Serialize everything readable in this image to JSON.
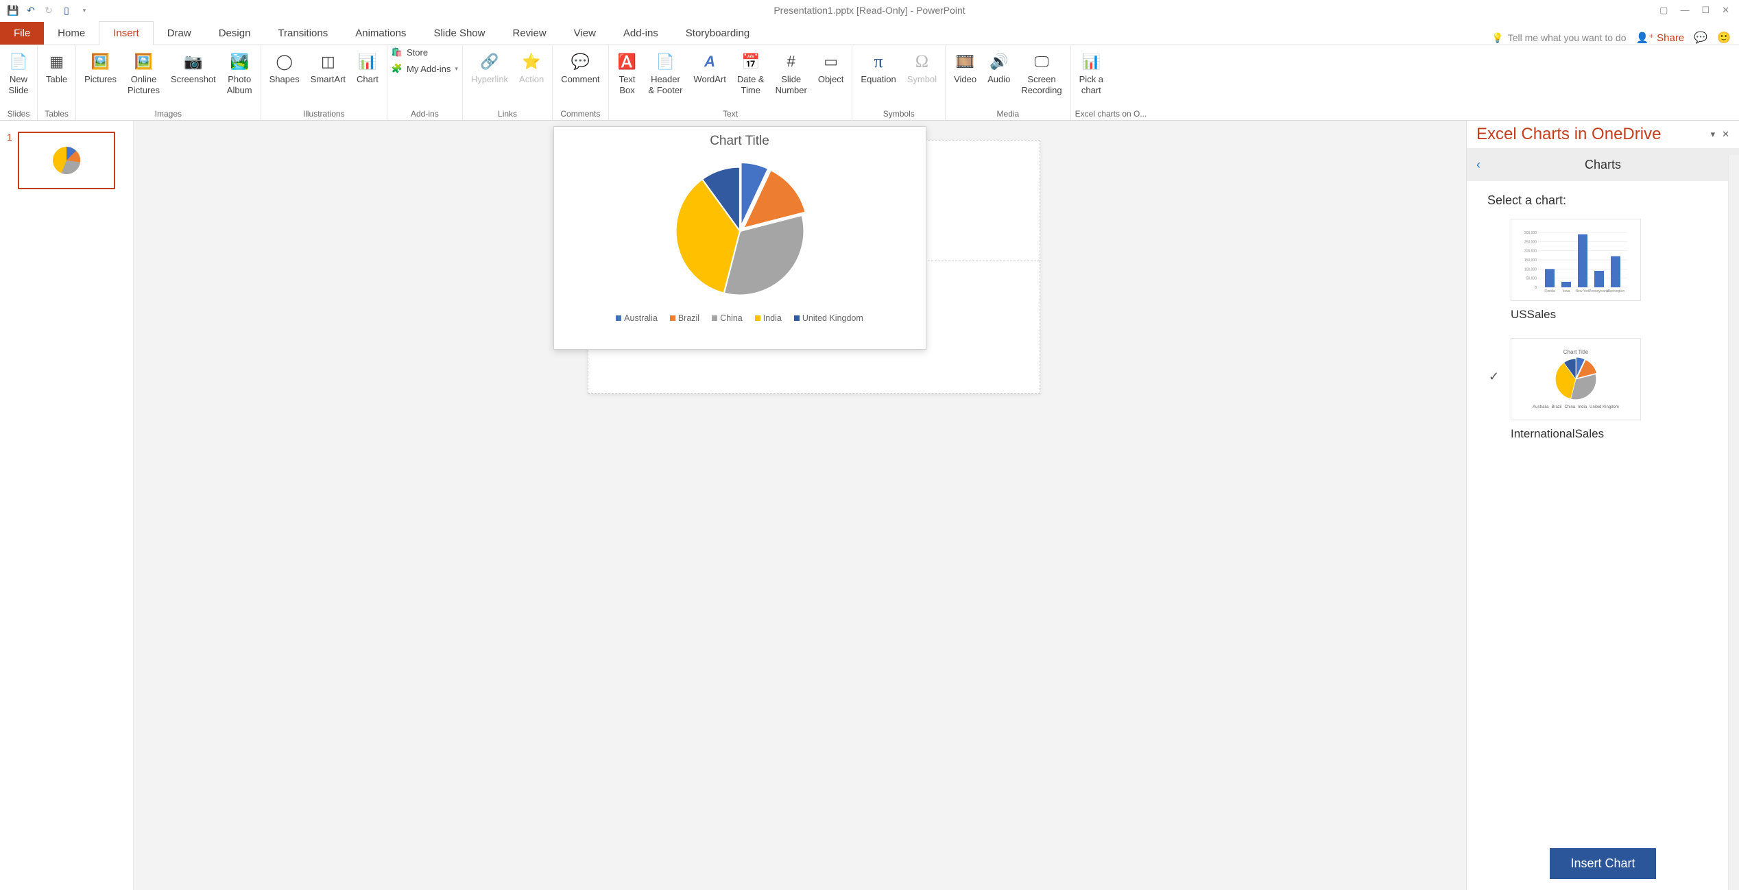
{
  "window": {
    "title": "Presentation1.pptx [Read-Only] - PowerPoint"
  },
  "tabs": {
    "file": "File",
    "list": [
      "Home",
      "Insert",
      "Draw",
      "Design",
      "Transitions",
      "Animations",
      "Slide Show",
      "Review",
      "View",
      "Add-ins",
      "Storyboarding"
    ],
    "active": "Insert",
    "tellme": "Tell me what you want to do",
    "share": "Share"
  },
  "ribbon": {
    "slides": {
      "label": "Slides",
      "new_slide": "New\nSlide"
    },
    "tables": {
      "label": "Tables",
      "table": "Table"
    },
    "images": {
      "label": "Images",
      "pictures": "Pictures",
      "online_pictures": "Online\nPictures",
      "screenshot": "Screenshot",
      "photo_album": "Photo\nAlbum"
    },
    "illustrations": {
      "label": "Illustrations",
      "shapes": "Shapes",
      "smartart": "SmartArt",
      "chart": "Chart"
    },
    "addins": {
      "label": "Add-ins",
      "store": "Store",
      "myaddins": "My Add-ins"
    },
    "links": {
      "label": "Links",
      "hyperlink": "Hyperlink",
      "action": "Action"
    },
    "comments": {
      "label": "Comments",
      "comment": "Comment"
    },
    "text": {
      "label": "Text",
      "text_box": "Text\nBox",
      "header_footer": "Header\n& Footer",
      "wordart": "WordArt",
      "date_time": "Date &\nTime",
      "slide_number": "Slide\nNumber",
      "object": "Object"
    },
    "symbols": {
      "label": "Symbols",
      "equation": "Equation",
      "symbol": "Symbol"
    },
    "media": {
      "label": "Media",
      "video": "Video",
      "audio": "Audio",
      "screen_recording": "Screen\nRecording"
    },
    "excel_charts": {
      "label": "Excel charts on O...",
      "pick": "Pick a\nchart"
    }
  },
  "slide_panel": {
    "slide_number": "1"
  },
  "chart_data": {
    "type": "pie",
    "title": "Chart Title",
    "categories": [
      "Australia",
      "Brazil",
      "China",
      "India",
      "United Kingdom"
    ],
    "values": [
      7,
      14,
      33,
      36,
      10
    ],
    "colors": [
      "#4472c4",
      "#ed7d31",
      "#a5a5a5",
      "#ffc000",
      "#325aa1"
    ]
  },
  "task_pane": {
    "title": "Excel Charts in OneDrive",
    "nav_title": "Charts",
    "select_label": "Select a chart:",
    "option1_label": "USSales",
    "option2_label": "InternationalSales",
    "insert_button": "Insert Chart",
    "us_bar": {
      "categories": [
        "Florida",
        "Iowa",
        "New York",
        "Pennsylvania",
        "Washington"
      ],
      "values": [
        100000,
        30000,
        290000,
        90000,
        170000
      ],
      "yticks": [
        0,
        50000,
        100000,
        150000,
        200000,
        250000,
        300000
      ]
    }
  }
}
